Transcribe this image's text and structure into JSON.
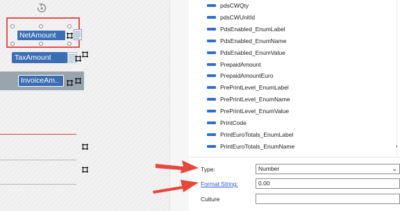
{
  "designer": {
    "fields": {
      "net_amount": "NetAmount",
      "tax_amount": "TaxAmount",
      "invoice_amount": "InvoiceAm.."
    },
    "colors": {
      "field_blue": "#3b6eb5",
      "selection_red": "#e5504f",
      "row_band": "#9aa4ad"
    }
  },
  "field_list": {
    "items": [
      "pdsCWQty",
      "pdsCWUnitId",
      "PdsEnabled_EnumLabel",
      "PdsEnabled_EnumName",
      "PdsEnabled_EnumValue",
      "PrepaidAmount",
      "PrepaidAmountEuro",
      "PrePrintLevel_EnumLabel",
      "PrePrintLevel_EnumName",
      "PrePrintLevel_EnumValue",
      "PrintCode",
      "PrintEuroTotals_EnumLabel",
      "PrintEuroTotals_EnumName"
    ],
    "icon_name": "field-icon",
    "icon_color": "#2e6fd1"
  },
  "properties": {
    "type_label": "Type:",
    "type_value": "Number",
    "format_label": "Format String:",
    "format_value": "0.00",
    "culture_label": "Culture",
    "culture_value": ""
  },
  "annotation_color": "#e8473b"
}
